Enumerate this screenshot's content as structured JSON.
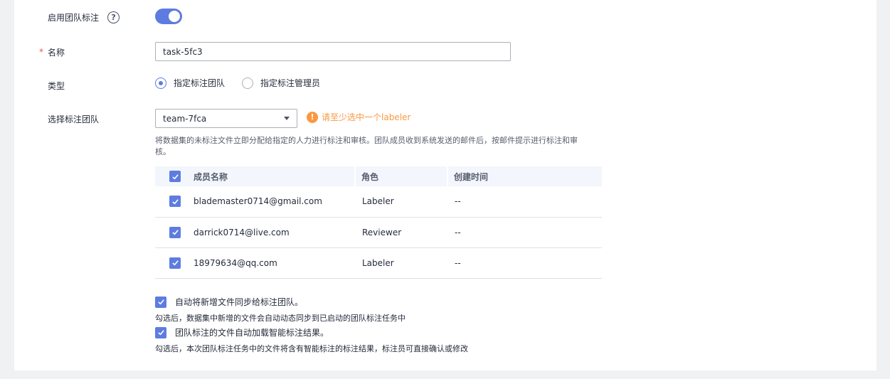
{
  "form": {
    "team_label": "启用团队标注",
    "team_enabled": true,
    "name_required_mark": "*",
    "name_label": "名称",
    "name_value": "task-5fc3",
    "type_label": "类型",
    "type_options": [
      "指定标注团队",
      "指定标注管理员"
    ],
    "type_selected": "指定标注团队",
    "team_select_label": "选择标注团队",
    "team_select_value": "team-7fca",
    "warning": "请至少选中一个labeler",
    "description": "将数据集的未标注文件立即分配给指定的人力进行标注和审核。团队成员收到系统发送的邮件后，按邮件提示进行标注和审核。"
  },
  "table": {
    "headers": [
      "成员名称",
      "角色",
      "创建时间"
    ],
    "rows": [
      {
        "name": "blademaster0714@gmail.com",
        "role": "Labeler",
        "time": "--"
      },
      {
        "name": "darrick0714@live.com",
        "role": "Reviewer",
        "time": "--"
      },
      {
        "name": "18979634@qq.com",
        "role": "Labeler",
        "time": "--"
      }
    ]
  },
  "options": {
    "auto_sync_label": "自动将新增文件同步给标注团队。",
    "auto_sync_hint": "勾选后，数据集中新增的文件会自动动态同步到已启动的团队标注任务中",
    "auto_load_label": "团队标注的文件自动加载智能标注结果。",
    "auto_load_hint": "勾选后，本次团队标注任务中的文件将含有智能标注的标注结果，标注员可直接确认或修改"
  },
  "colors": {
    "accent": "#5e7ce0",
    "warning": "#fa9841",
    "required": "#e05a4f"
  }
}
